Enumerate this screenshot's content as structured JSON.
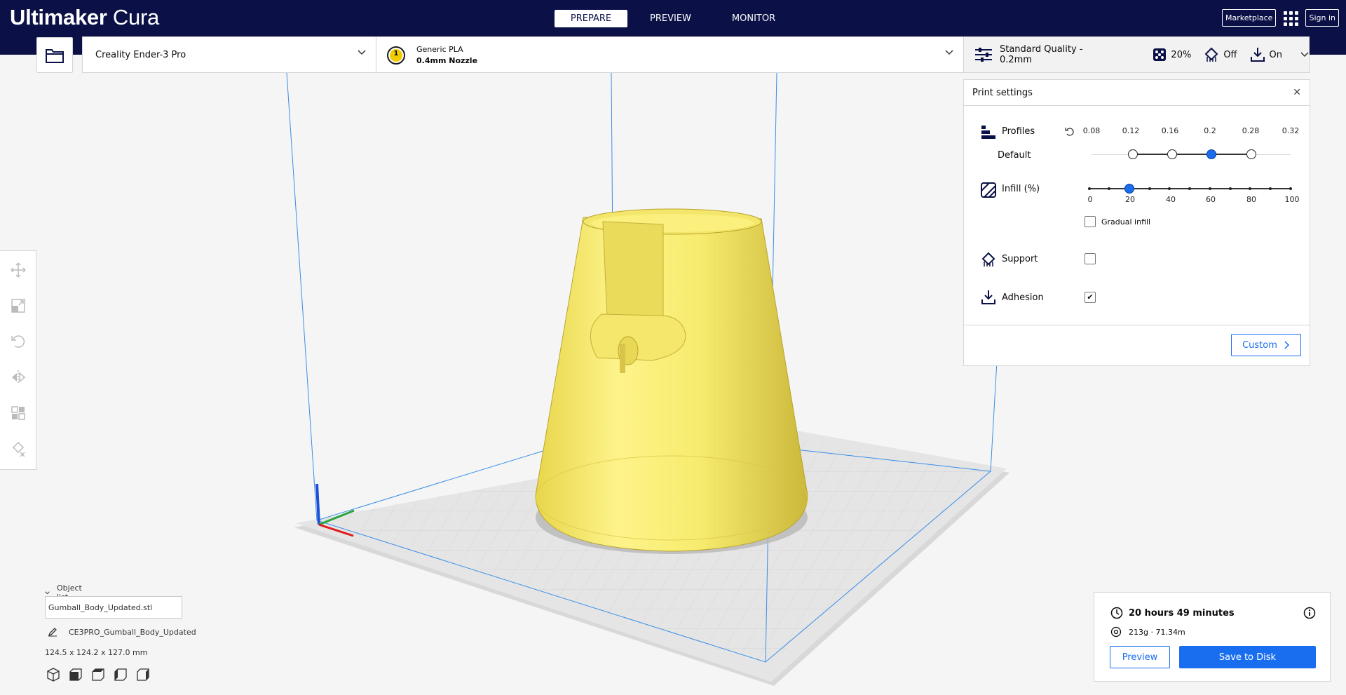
{
  "app": {
    "logo_bold": "Ultimaker",
    "logo_light": "Cura"
  },
  "stages": [
    {
      "label": "PREPARE",
      "active": true
    },
    {
      "label": "PREVIEW",
      "active": false
    },
    {
      "label": "MONITOR",
      "active": false
    }
  ],
  "header_right": {
    "marketplace": "Marketplace",
    "signin": "Sign in",
    "apps_icon": "grid-icon"
  },
  "printer": {
    "name": "Creality Ender-3 Pro"
  },
  "material": {
    "extruder": "1",
    "name": "Generic PLA",
    "nozzle": "0.4mm Nozzle",
    "color": "#f0cc00"
  },
  "quality_bar": {
    "profile": "Standard Quality - 0.2mm",
    "infill": "20%",
    "support": "Off",
    "adhesion": "On"
  },
  "print_settings": {
    "title": "Print settings",
    "profiles": {
      "label": "Profiles",
      "sublabel": "Default",
      "ticks": [
        "0.08",
        "0.12",
        "0.16",
        "0.2",
        "0.28",
        "0.32"
      ],
      "selected": "0.2"
    },
    "infill": {
      "label": "Infill (%)",
      "ticks": [
        "0",
        "20",
        "40",
        "60",
        "80",
        "100"
      ],
      "value": 20,
      "gradual_label": "Gradual infill",
      "gradual_checked": false
    },
    "support": {
      "label": "Support",
      "checked": false
    },
    "adhesion": {
      "label": "Adhesion",
      "checked": true
    },
    "custom_button": "Custom"
  },
  "object_list": {
    "toggle_label": "Object list",
    "file": "Gumball_Body_Updated.stl",
    "job_name": "CE3PRO_Gumball_Body_Updated",
    "dimensions": "124.5 x 124.2 x 127.0 mm"
  },
  "summary": {
    "time": "20 hours 49 minutes",
    "material": "213g · 71.34m",
    "preview_button": "Preview",
    "save_button": "Save to Disk"
  },
  "colors": {
    "topbar": "#0b1146",
    "accent": "#196ef0",
    "model": "#f7ec6e"
  }
}
